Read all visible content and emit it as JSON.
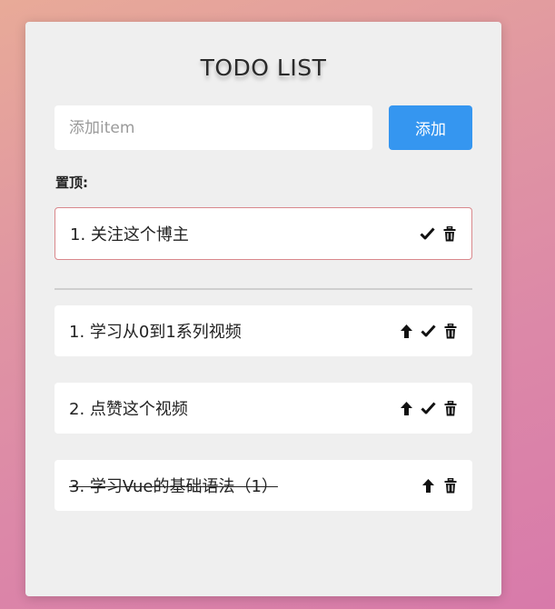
{
  "app": {
    "title": "TODO LIST"
  },
  "add_form": {
    "placeholder": "添加item",
    "value": "",
    "button_label": "添加"
  },
  "pinned": {
    "label": "置顶:",
    "items": [
      {
        "text": "1. 关注这个博主",
        "done": false
      }
    ]
  },
  "todos": [
    {
      "text": "1. 学习从0到1系列视频",
      "done": false
    },
    {
      "text": "2. 点赞这个视频",
      "done": false
    },
    {
      "text": "3. 学习Vue的基础语法（1）",
      "done": true
    }
  ],
  "icons": {
    "pin_up": "arrow-up-icon",
    "complete": "check-icon",
    "delete": "trash-icon"
  },
  "colors": {
    "accent": "#3596f0",
    "pinned_border": "#d9888c",
    "card_bg": "#efefef"
  }
}
